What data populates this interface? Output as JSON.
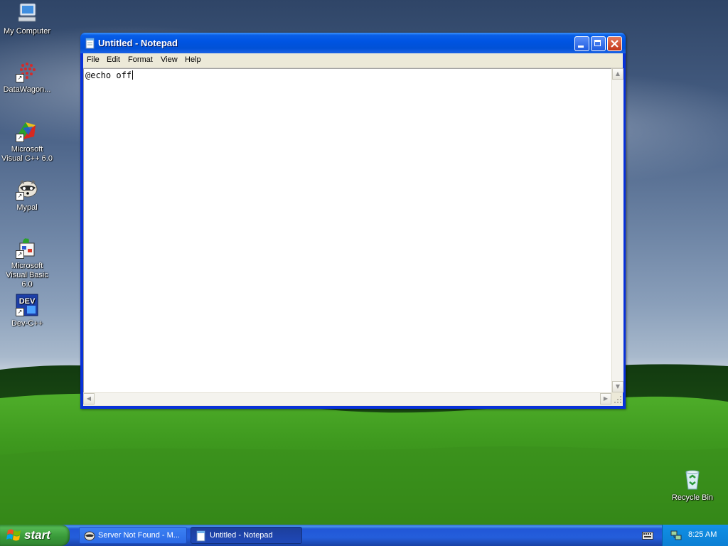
{
  "desktop": {
    "icons": [
      {
        "label": "My Computer",
        "icon": "my-computer-icon"
      },
      {
        "label": "DataWagon...",
        "icon": "datawagon-icon"
      },
      {
        "label": "Microsoft Visual C++ 6.0",
        "icon": "visual-cpp-icon"
      },
      {
        "label": "Mypal",
        "icon": "mypal-icon"
      },
      {
        "label": "Microsoft Visual Basic 6.0",
        "icon": "visual-basic-icon"
      },
      {
        "label": "Dev-C++",
        "icon": "dev-cpp-icon"
      },
      {
        "label": "Recycle Bin",
        "icon": "recycle-bin-icon"
      }
    ]
  },
  "window": {
    "title": "Untitled - Notepad",
    "icon": "notepad-icon",
    "menu": [
      "File",
      "Edit",
      "Format",
      "View",
      "Help"
    ],
    "content": "@echo off",
    "buttons": [
      "minimize",
      "maximize",
      "close"
    ]
  },
  "taskbar": {
    "start_label": "start",
    "tasks": [
      {
        "label": "Server Not Found - M...",
        "icon": "mypal-icon",
        "active": false
      },
      {
        "label": "Untitled - Notepad",
        "icon": "notepad-icon",
        "active": true
      }
    ],
    "clock": "8:25 AM"
  }
}
